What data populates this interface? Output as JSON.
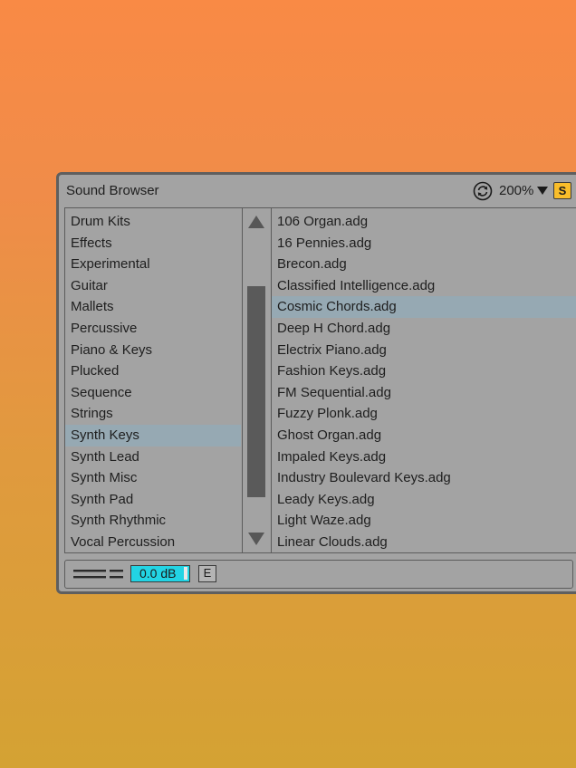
{
  "window": {
    "title": "Sound Browser",
    "zoom_label": "200%",
    "solo_label": "S"
  },
  "categories": {
    "items": [
      {
        "label": "Drum Kits"
      },
      {
        "label": "Effects"
      },
      {
        "label": "Experimental"
      },
      {
        "label": "Guitar"
      },
      {
        "label": "Mallets"
      },
      {
        "label": "Percussive"
      },
      {
        "label": "Piano & Keys"
      },
      {
        "label": "Plucked"
      },
      {
        "label": "Sequence"
      },
      {
        "label": "Strings"
      },
      {
        "label": "Synth Keys"
      },
      {
        "label": "Synth Lead"
      },
      {
        "label": "Synth Misc"
      },
      {
        "label": "Synth Pad"
      },
      {
        "label": "Synth Rhythmic"
      },
      {
        "label": "Vocal Percussion"
      }
    ],
    "selected": "Synth Keys"
  },
  "files": {
    "items": [
      {
        "label": "106 Organ.adg"
      },
      {
        "label": "16 Pennies.adg"
      },
      {
        "label": "Brecon.adg"
      },
      {
        "label": "Classified Intelligence.adg"
      },
      {
        "label": "Cosmic Chords.adg"
      },
      {
        "label": "Deep H Chord.adg"
      },
      {
        "label": "Electrix Piano.adg"
      },
      {
        "label": "Fashion Keys.adg"
      },
      {
        "label": "FM Sequential.adg"
      },
      {
        "label": "Fuzzy Plonk.adg"
      },
      {
        "label": "Ghost Organ.adg"
      },
      {
        "label": "Impaled Keys.adg"
      },
      {
        "label": "Industry Boulevard Keys.adg"
      },
      {
        "label": "Leady Keys.adg"
      },
      {
        "label": "Light Waze.adg"
      },
      {
        "label": "Linear Clouds.adg"
      }
    ],
    "selected": "Cosmic Chords.adg"
  },
  "footer": {
    "volume_value": "0.0 dB",
    "edit_label": "E"
  },
  "icons": {
    "refresh": "refresh-icon",
    "zoom_dropdown": "triangle-down-icon",
    "meter": "level-meter-icon",
    "scroll_up": "triangle-up-icon",
    "scroll_down": "triangle-down-icon"
  },
  "colors": {
    "background_top": "#f98a45",
    "background_bottom": "#d4a233",
    "window_bg": "#a3a3a3",
    "selection": "#96a9b3",
    "solo_button": "#f9bd2a",
    "volume_field": "#22d4e4"
  }
}
